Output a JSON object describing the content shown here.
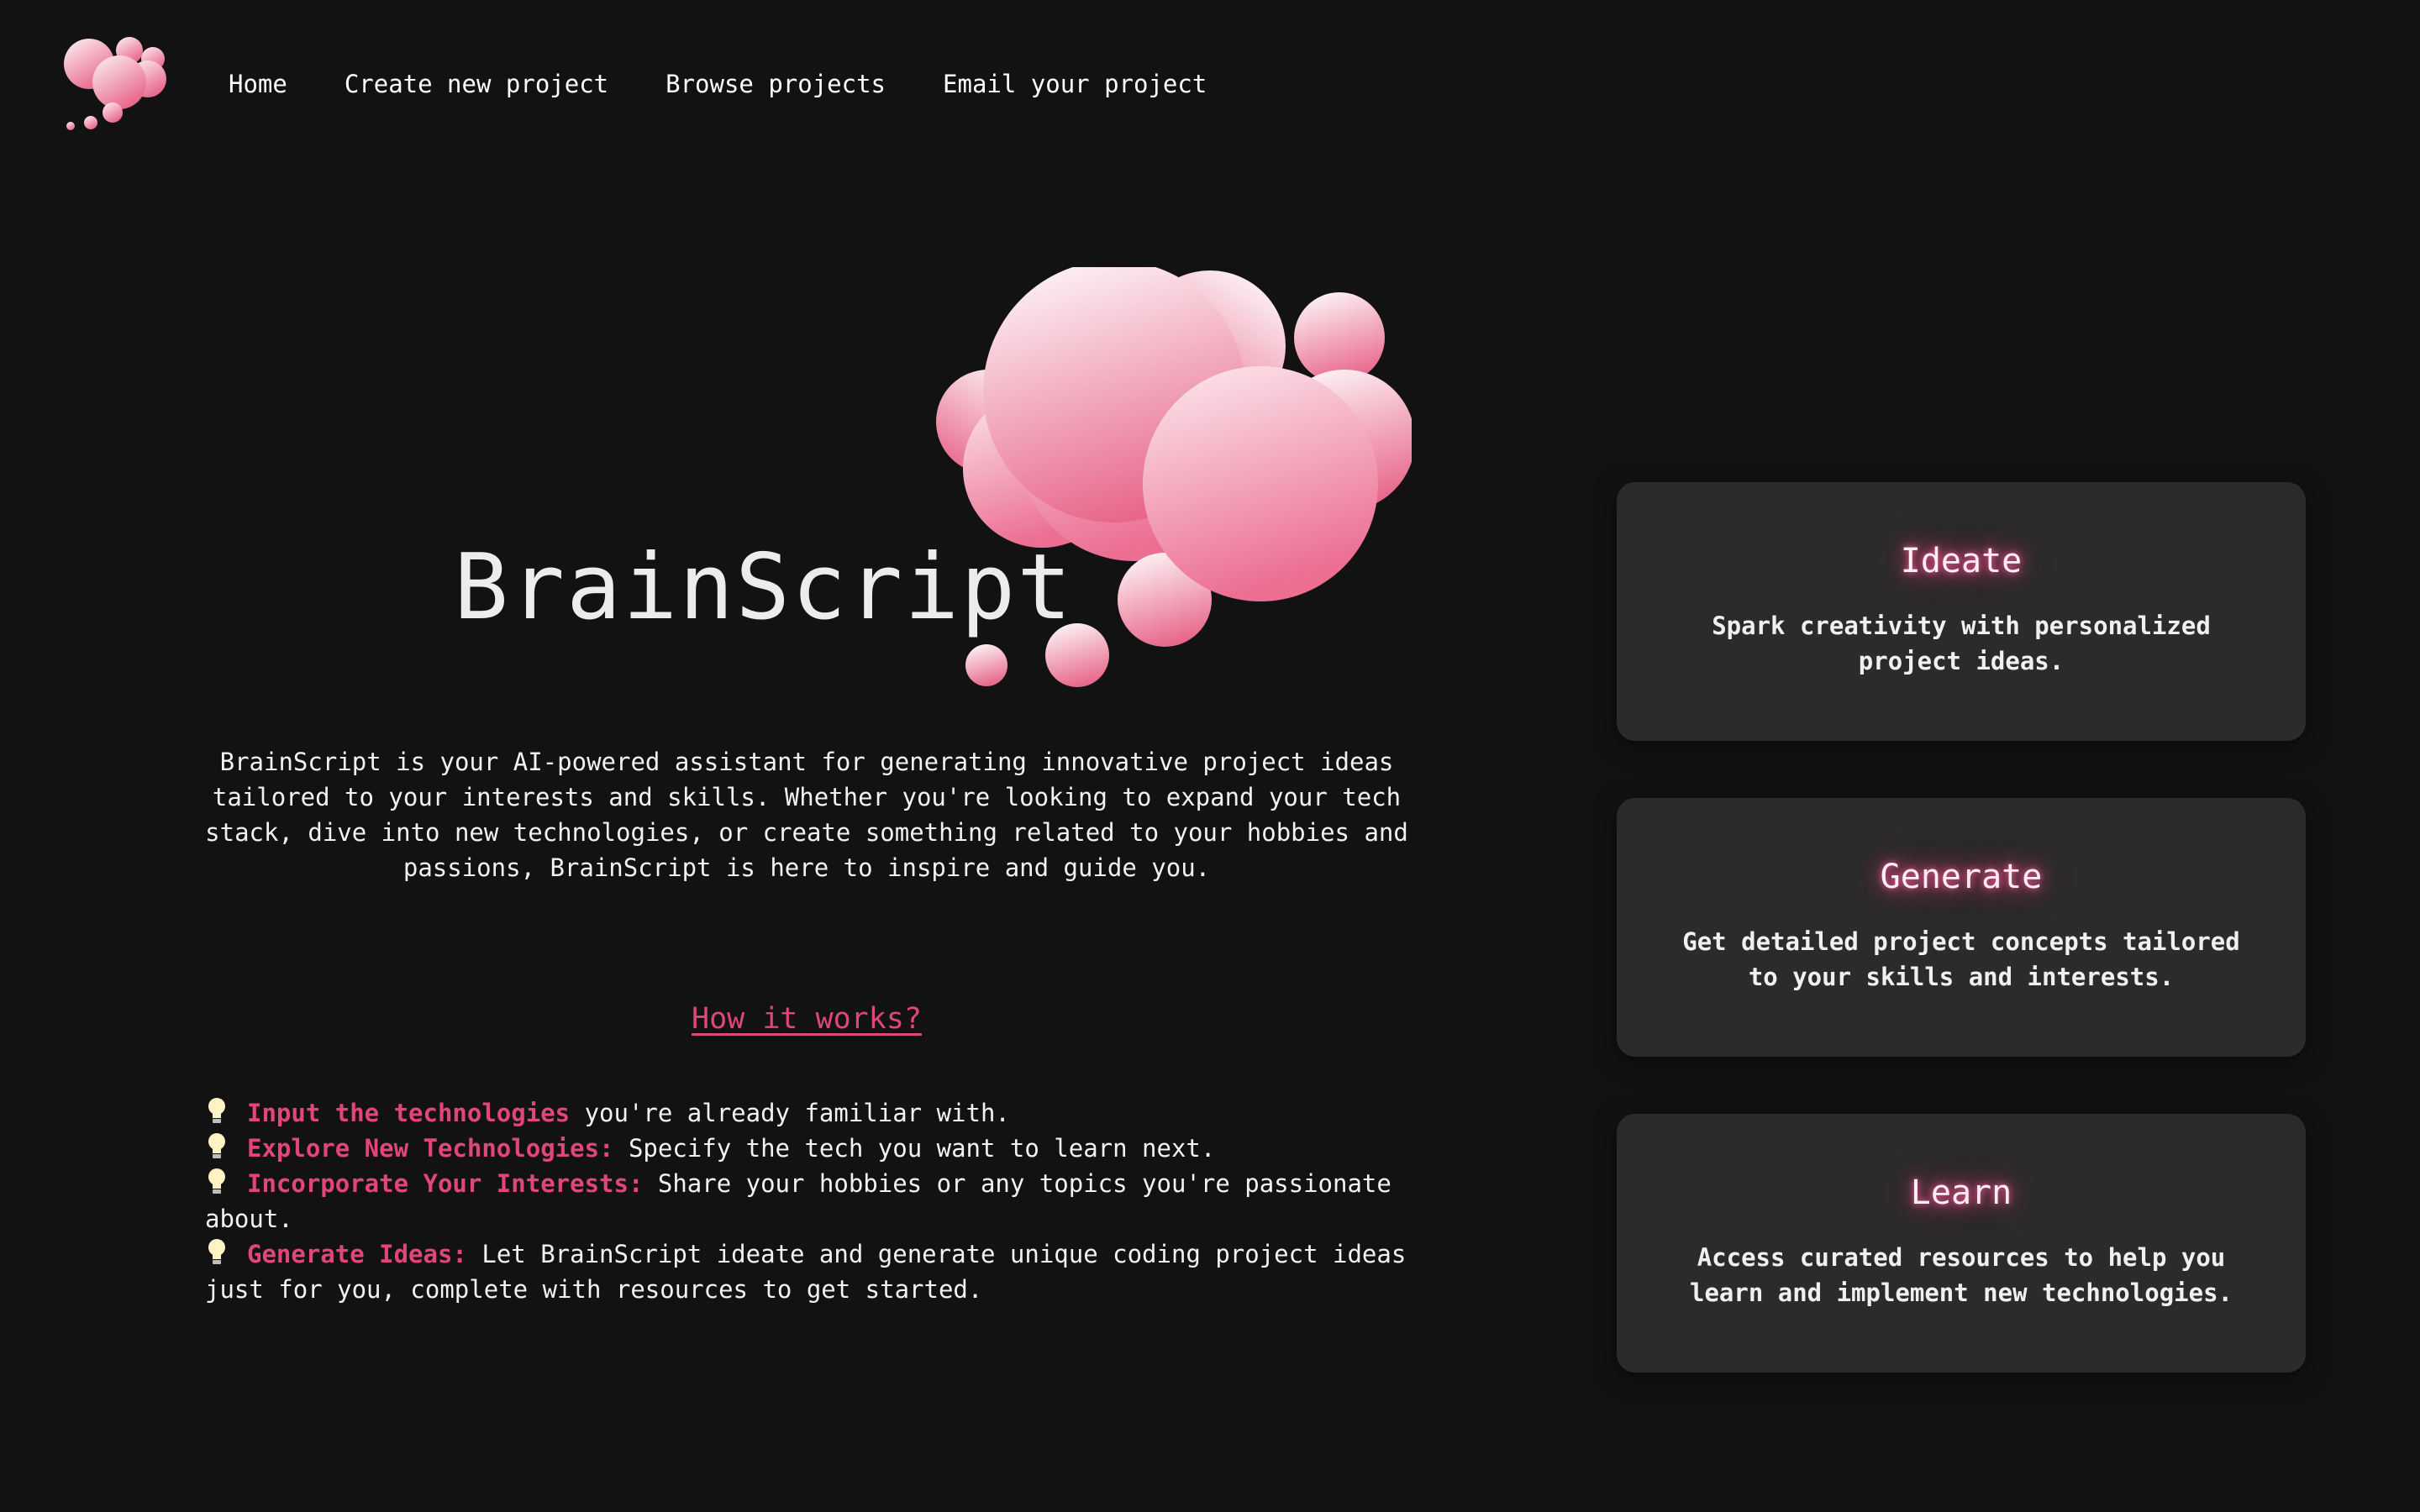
{
  "nav": {
    "items": [
      {
        "label": "Home"
      },
      {
        "label": "Create new project"
      },
      {
        "label": "Browse projects"
      },
      {
        "label": "Email your project"
      }
    ]
  },
  "hero": {
    "title": "BrainScript",
    "description": "BrainScript is your AI-powered assistant for generating innovative project ideas tailored to your interests and skills. Whether you're looking to expand your tech stack, dive into new technologies, or create something related to your hobbies and passions, BrainScript is here to inspire and guide you."
  },
  "how": {
    "title": "How it works?",
    "steps": [
      {
        "label": "Input the technologies",
        "text": " you're already familiar with."
      },
      {
        "label": "Explore New Technologies:",
        "text": " Specify the tech you want to learn next."
      },
      {
        "label": "Incorporate Your Interests:",
        "text": " Share your hobbies or any topics you're passionate about."
      },
      {
        "label": "Generate Ideas:",
        "text": " Let BrainScript ideate and generate unique coding project ideas just for you, complete with resources to get started."
      }
    ]
  },
  "cards": [
    {
      "title": "Ideate",
      "description": "Spark creativity with personalized project ideas."
    },
    {
      "title": "Generate",
      "description": "Get detailed project concepts tailored to your skills and interests."
    },
    {
      "title": "Learn",
      "description": "Access curated resources to help you learn and implement new technologies."
    }
  ],
  "colors": {
    "background": "#121212",
    "accent": "#e0457b",
    "card_background": "#2b2b2b",
    "bubble_light": "#fdf4f6",
    "bubble_dark": "#e8678a"
  },
  "icons": {
    "logo": "brain-cloud-logo-icon",
    "step_bullet": "lightbulb-icon"
  }
}
